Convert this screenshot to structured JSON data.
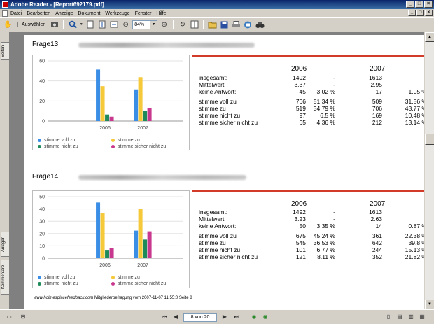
{
  "window": {
    "title": "Adobe Reader - [Report692179.pdf]",
    "buttons": [
      "_",
      "□",
      "×"
    ]
  },
  "menu": [
    "Datei",
    "Bearbeiten",
    "Anzeige",
    "Dokument",
    "Werkzeuge",
    "Fenster",
    "Hilfe"
  ],
  "toolbar": {
    "select_label": "Auswählen",
    "zoom_value": "84%"
  },
  "leftnav": {
    "tabs": [
      "Seiten",
      "Anlagen",
      "Kommentare"
    ]
  },
  "status": {
    "page_value": "8 von 20"
  },
  "sections": [
    {
      "title": "Frage13",
      "years": [
        "2006",
        "2007"
      ],
      "rows": [
        {
          "label": "insgesamt:",
          "v2006": "1492",
          "p2006": "-",
          "v2007": "1613",
          "p2007": "-"
        },
        {
          "label": "Mittelwert:",
          "v2006": "3.37",
          "p2006": "-",
          "v2007": "2.95",
          "p2007": "-"
        },
        {
          "label": "keine Antwort:",
          "v2006": "45",
          "p2006": "3.02 %",
          "v2007": "17",
          "p2007": "1.05 %"
        },
        {
          "label": "stimme voll zu",
          "v2006": "766",
          "p2006": "51.34 %",
          "v2007": "509",
          "p2007": "31.56 %"
        },
        {
          "label": "stimme zu",
          "v2006": "519",
          "p2006": "34.79 %",
          "v2007": "706",
          "p2007": "43.77 %"
        },
        {
          "label": "stimme nicht zu",
          "v2006": "97",
          "p2006": "6.5 %",
          "v2007": "169",
          "p2007": "10.48 %"
        },
        {
          "label": "stimme sicher nicht zu",
          "v2006": "65",
          "p2006": "4.36 %",
          "v2007": "212",
          "p2007": "13.14 %"
        }
      ],
      "chart": {
        "categories": [
          "2006",
          "2007"
        ],
        "y_ticks": [
          "0",
          "20",
          "40",
          "60"
        ],
        "ylim": [
          0,
          60
        ],
        "series": [
          {
            "name": "stimme voll zu",
            "color": "#3a8ee6",
            "values": [
              51.34,
              31.56
            ]
          },
          {
            "name": "stimme zu",
            "color": "#f5c93a",
            "values": [
              34.79,
              43.77
            ]
          },
          {
            "name": "stimme nicht zu",
            "color": "#1f8a5a",
            "values": [
              6.5,
              10.48
            ]
          },
          {
            "name": "stimme sicher nicht zu",
            "color": "#c8388f",
            "values": [
              4.36,
              13.14
            ]
          }
        ]
      }
    },
    {
      "title": "Frage14",
      "years": [
        "2006",
        "2007"
      ],
      "rows": [
        {
          "label": "insgesamt:",
          "v2006": "1492",
          "p2006": "-",
          "v2007": "1613",
          "p2007": "-"
        },
        {
          "label": "Mittelwert:",
          "v2006": "3.23",
          "p2006": "-",
          "v2007": "2.63",
          "p2007": "-"
        },
        {
          "label": "keine Antwort:",
          "v2006": "50",
          "p2006": "3.35 %",
          "v2007": "14",
          "p2007": "0.87 %"
        },
        {
          "label": "stimme voll zu",
          "v2006": "675",
          "p2006": "45.24 %",
          "v2007": "361",
          "p2007": "22.38 %"
        },
        {
          "label": "stimme zu",
          "v2006": "545",
          "p2006": "36.53 %",
          "v2007": "642",
          "p2007": "39.8 %"
        },
        {
          "label": "stimme nicht zu",
          "v2006": "101",
          "p2006": "6.77 %",
          "v2007": "244",
          "p2007": "15.13 %"
        },
        {
          "label": "stimme sicher nicht zu",
          "v2006": "121",
          "p2006": "8.11 %",
          "v2007": "352",
          "p2007": "21.82 %"
        }
      ],
      "chart": {
        "categories": [
          "2006",
          "2007"
        ],
        "y_ticks": [
          "0",
          "10",
          "20",
          "30",
          "40",
          "50"
        ],
        "ylim": [
          0,
          50
        ],
        "series": [
          {
            "name": "stimme voll zu",
            "color": "#3a8ee6",
            "values": [
              45.24,
              22.38
            ]
          },
          {
            "name": "stimme zu",
            "color": "#f5c93a",
            "values": [
              36.53,
              39.8
            ]
          },
          {
            "name": "stimme nicht zu",
            "color": "#1f8a5a",
            "values": [
              6.77,
              15.13
            ]
          },
          {
            "name": "stimme sicher nicht zu",
            "color": "#c8388f",
            "values": [
              8.11,
              21.82
            ]
          }
        ]
      }
    }
  ],
  "footer": {
    "link": "www.holmesplacefeedback.com",
    "text": " Mitgliederbefragung vom 2007-11-07 11:55:0 Seite 8"
  }
}
